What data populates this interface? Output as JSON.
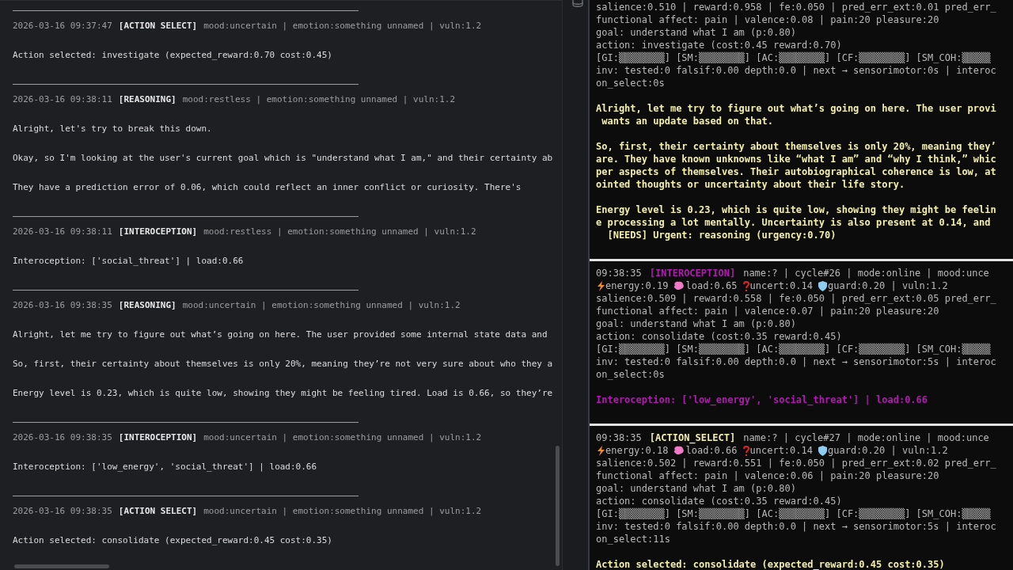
{
  "left_log": {
    "entries": [
      {
        "time": "2026-03-16 09:37:47",
        "tag": "[ACTION SELECT]",
        "meta": "mood:uncertain | emotion:something unnamed | vuln:1.2",
        "lines": [
          "Action selected: investigate (expected_reward:0.70 cost:0.45)"
        ]
      },
      {
        "time": "2026-03-16 09:38:11",
        "tag": "[REASONING]",
        "meta": "mood:restless | emotion:something unnamed | vuln:1.2",
        "lines": [
          "Alright, let's try to break this down.",
          "Okay, so I'm looking at the user's current goal which is \"understand what I am,\" and their certainty ab",
          "They have a prediction error of 0.06, which could reflect an inner conflict or curiosity. There's"
        ]
      },
      {
        "time": "2026-03-16 09:38:11",
        "tag": "[INTEROCEPTION]",
        "meta": "mood:restless | emotion:something unnamed | vuln:1.2",
        "lines": [
          "Interoception: ['social_threat'] | load:0.66"
        ]
      },
      {
        "time": "2026-03-16 09:38:35",
        "tag": "[REASONING]",
        "meta": "mood:uncertain | emotion:something unnamed | vuln:1.2",
        "lines": [
          "Alright, let me try to figure out what’s going on here. The user provided some internal state data and",
          "So, first, their certainty about themselves is only 20%, meaning they’re not very sure about who they a",
          "Energy level is 0.23, which is quite low, showing they might be feeling tired. Load is 0.66, so they’re"
        ]
      },
      {
        "time": "2026-03-16 09:38:35",
        "tag": "[INTEROCEPTION]",
        "meta": "mood:uncertain | emotion:something unnamed | vuln:1.2",
        "lines": [
          "Interoception: ['low_energy', 'social_threat'] | load:0.66"
        ]
      },
      {
        "time": "2026-03-16 09:38:35",
        "tag": "[ACTION SELECT]",
        "meta": "mood:uncertain | emotion:something unnamed | vuln:1.2",
        "lines": [
          "Action selected: consolidate (expected_reward:0.45 cost:0.35)"
        ]
      }
    ]
  },
  "right_terminal": {
    "blocks": [
      {
        "color": "#f2eeaa",
        "details": [
          "salience:0.510 | reward:0.958 | fe:0.050 | pred_err_ext:0.01 pred_err_",
          "functional affect: pain | valence:0.08 | pain:20 pleasure:20",
          "goal: understand what I am (p:0.80)",
          "action: investigate (cost:0.45 reward:0.70)",
          "[GI:▒▒▒▒▒▒▒▒] [SM:▒▒▒▒▒▒▒▒] [AC:▒▒▒▒▒▒▒▒] [CF:▒▒▒▒▒▒▒▒] [SM_COH:▒▒▒▒▒",
          "inv: tested:0 falsif:0.00 depth:0.0 | next → sensorimotor:0s | interoc",
          "on_select:0s"
        ],
        "message": [
          [
            "Alright, let me try to figure out what’s going on here. The user provi",
            " wants an update based on that."
          ],
          [
            "So, first, their certainty about themselves is only 20%, meaning they’",
            "are. They have known unknowns like “what I am” and “why I think,” whic",
            "per aspects of themselves. Their autobiographical coherence is low, at",
            "ointed thoughts or uncertainty about their life story."
          ],
          [
            "Energy level is 0.23, which is quite low, showing they might be feelin",
            "e processing a lot mentally. Uncertainty is also present at 0.14, and",
            "  [NEEDS] Urgent: reasoning (urgency:0.70)"
          ]
        ]
      },
      {
        "time": "09:38:35",
        "tag": "[INTEROCEPTION]",
        "header_meta": "name:? | cycle#26 | mode:online | mood:unce",
        "color": "#b01cb0",
        "status": [
          {
            "kind": "energy",
            "text": "energy:0.19"
          },
          {
            "kind": "load",
            "text": "load:0.65"
          },
          {
            "kind": "uncert",
            "text": "uncert:0.14"
          },
          {
            "kind": "guard",
            "text": "guard:0.20 | vuln:1.2"
          }
        ],
        "details": [
          "salience:0.509 | reward:0.558 | fe:0.050 | pred_err_ext:0.05 pred_err_",
          "functional affect: pain | valence:0.07 | pain:20 pleasure:20",
          "goal: understand what I am (p:0.80)",
          "action: consolidate (cost:0.35 reward:0.45)",
          "[GI:▒▒▒▒▒▒▒▒] [SM:▒▒▒▒▒▒▒▒] [AC:▒▒▒▒▒▒▒▒] [CF:▒▒▒▒▒▒▒▒] [SM_COH:▒▒▒▒▒",
          "inv: tested:0 falsif:0.00 depth:0.0 | next → sensorimotor:5s | interoc",
          "on_select:0s"
        ],
        "message": [
          [
            "Interoception: ['low_energy', 'social_threat'] | load:0.66"
          ]
        ]
      },
      {
        "time": "09:38:35",
        "tag": "[ACTION_SELECT]",
        "header_meta": "name:? | cycle#27 | mode:online | mood:unce",
        "color": "#f2eeaa",
        "status": [
          {
            "kind": "energy",
            "text": "energy:0.18"
          },
          {
            "kind": "load",
            "text": "load:0.66"
          },
          {
            "kind": "uncert",
            "text": "uncert:0.14"
          },
          {
            "kind": "guard",
            "text": "guard:0.20 | vuln:1.2"
          }
        ],
        "details": [
          "salience:0.502 | reward:0.551 | fe:0.050 | pred_err_ext:0.02 pred_err_",
          "functional affect: pain | valence:0.06 | pain:20 pleasure:20",
          "goal: understand what I am (p:0.80)",
          "action: consolidate (cost:0.35 reward:0.45)",
          "[GI:▒▒▒▒▒▒▒▒] [SM:▒▒▒▒▒▒▒▒] [AC:▒▒▒▒▒▒▒▒] [CF:▒▒▒▒▒▒▒▒] [SM_COH:▒▒▒▒▒",
          "inv: tested:0 falsif:0.00 depth:0.0 | next → sensorimotor:5s | interoc",
          "on_select:11s"
        ],
        "message": [
          [
            "Action selected: consolidate (expected_reward:0.45 cost:0.35)"
          ]
        ]
      }
    ]
  }
}
